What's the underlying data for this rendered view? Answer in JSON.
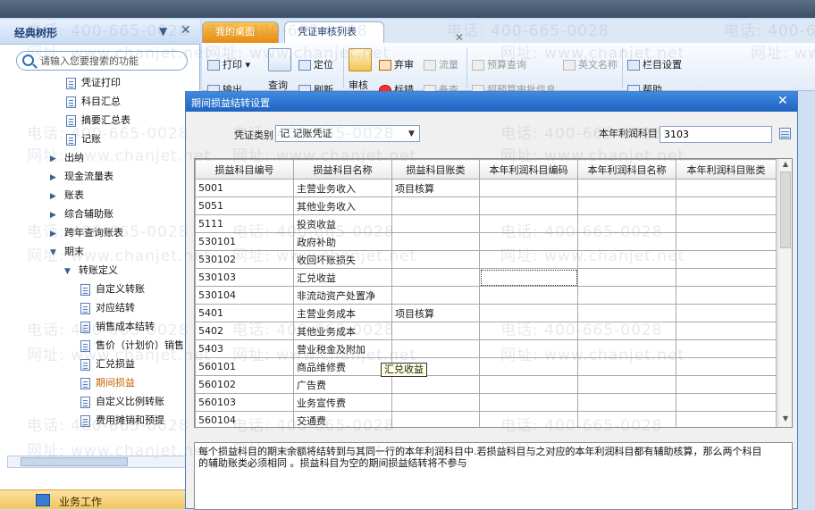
{
  "left_panel": {
    "title": "经典树形",
    "search_placeholder": "请输入您要搜索的功能",
    "items": [
      {
        "label": "凭证打印",
        "type": "doc"
      },
      {
        "label": "科目汇总",
        "type": "doc"
      },
      {
        "label": "摘要汇总表",
        "type": "doc"
      },
      {
        "label": "记账",
        "type": "doc"
      },
      {
        "label": "出纳",
        "type": "folder"
      },
      {
        "label": "现金流量表",
        "type": "folder"
      },
      {
        "label": "账表",
        "type": "folder"
      },
      {
        "label": "综合辅助账",
        "type": "folder"
      },
      {
        "label": "跨年查询账表",
        "type": "folder"
      },
      {
        "label": "期末",
        "type": "open"
      },
      {
        "label": "转账定义",
        "type": "open"
      },
      {
        "label": "自定义转账",
        "type": "doc"
      },
      {
        "label": "对应结转",
        "type": "doc"
      },
      {
        "label": "销售成本结转",
        "type": "doc"
      },
      {
        "label": "售价（计划价）销售",
        "type": "doc"
      },
      {
        "label": "汇兑损益",
        "type": "doc"
      },
      {
        "label": "期间损益",
        "type": "doc"
      },
      {
        "label": "自定义比例转账",
        "type": "doc"
      },
      {
        "label": "费用摊销和预提",
        "type": "doc"
      }
    ],
    "bottom_label": "业务工作"
  },
  "tabs": {
    "desktop": "我的桌面",
    "review_list": "凭证审核列表"
  },
  "toolbar": {
    "print": "打印",
    "output": "输出",
    "query": "查询",
    "locate": "定位",
    "refresh": "刷新",
    "review": "审核",
    "discard": "弃审",
    "mark": "标错",
    "flow": "流量",
    "remark": "备查",
    "budget_query": "预算查询",
    "linked_approval": "超预算审批信息",
    "english_name": "英文名称",
    "column_settings": "栏目设置",
    "help": "帮助"
  },
  "dialog": {
    "title": "期间损益结转设置",
    "voucher_type_label": "凭证类别",
    "voucher_type_value": "记 记账凭证",
    "profit_account_label": "本年利润科目",
    "profit_account_value": "3103",
    "columns": [
      "损益科目编号",
      "损益科目名称",
      "损益科目账类",
      "本年利润科目编码",
      "本年利润科目名称",
      "本年利润科目账类"
    ],
    "rows": [
      [
        "5001",
        "主营业务收入",
        "项目核算",
        "",
        "",
        ""
      ],
      [
        "5051",
        "其他业务收入",
        "",
        "",
        "",
        ""
      ],
      [
        "5111",
        "投资收益",
        "",
        "",
        "",
        ""
      ],
      [
        "530101",
        "政府补助",
        "",
        "",
        "",
        ""
      ],
      [
        "530102",
        "收回坏账损失",
        "",
        "",
        "",
        ""
      ],
      [
        "530103",
        "汇兑收益",
        "",
        "",
        "",
        ""
      ],
      [
        "530104",
        "非流动资产处置净",
        "",
        "",
        "",
        ""
      ],
      [
        "5401",
        "主营业务成本",
        "项目核算",
        "",
        "",
        ""
      ],
      [
        "5402",
        "其他业务成本",
        "",
        "",
        "",
        ""
      ],
      [
        "5403",
        "营业税金及附加",
        "",
        "",
        "",
        ""
      ],
      [
        "560101",
        "商品维修费",
        "",
        "",
        "",
        ""
      ],
      [
        "560102",
        "广告费",
        "",
        "",
        "",
        ""
      ],
      [
        "560103",
        "业务宣传费",
        "",
        "",
        "",
        ""
      ],
      [
        "560104",
        "交通费",
        "",
        "",
        "",
        ""
      ]
    ],
    "tooltip": "汇兑收益",
    "note": "每个损益科目的期末余额将结转到与其同一行的本年利润科目中.若损益科目与之对应的本年利润科目都有辅助核算，那么两个科目的辅助账类必须相同    。损益科目为空的期间损益结转将不参与"
  },
  "watermark": {
    "phone": "电话: 400-665-0028",
    "site": "网址: www.chanjet.net"
  }
}
